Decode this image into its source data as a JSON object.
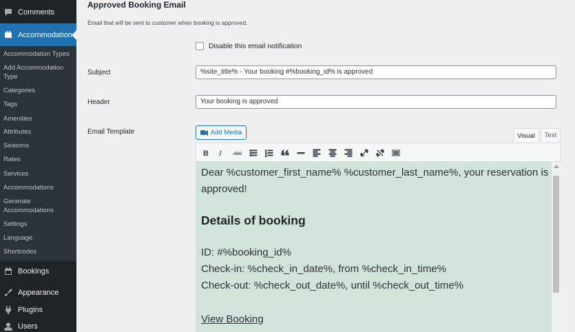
{
  "sidebar": {
    "comments_label": "Comments",
    "accommodation_label": "Accommodation",
    "submenu": [
      "Accommodation Types",
      "Add Accommodation Type",
      "Categories",
      "Tags",
      "Amenities",
      "Attributes",
      "Seasons",
      "Rates",
      "Services",
      "Accommodations",
      "Generate Accommodations",
      "Settings",
      "Language",
      "Shortcodes"
    ],
    "bookings_label": "Bookings",
    "appearance_label": "Appearance",
    "plugins_label": "Plugins",
    "users_label": "Users"
  },
  "section": {
    "title": "Approved Booking Email",
    "description": "Email that will be sent to customer when booking is approved."
  },
  "form": {
    "disable_label": "Disable this email notification",
    "subject_label": "Subject",
    "subject_value": "%site_title% - Your booking #%booking_id% is approved",
    "header_label": "Header",
    "header_value": "Your booking is approved",
    "template_label": "Email Template",
    "add_media_label": "Add Media",
    "tab_visual": "Visual",
    "tab_text": "Text"
  },
  "toolbar_icons": [
    "bold-icon",
    "italic-icon",
    "strikethrough-icon",
    "bullet-list-icon",
    "numbered-list-icon",
    "blockquote-icon",
    "horizontal-line-icon",
    "align-left-icon",
    "align-center-icon",
    "align-right-icon",
    "insert-link-icon",
    "remove-link-icon",
    "toolbar-toggle-icon"
  ],
  "editor": {
    "line1": "Dear %customer_first_name% %customer_last_name%, your reservation is",
    "line2": "approved!",
    "heading": "Details of booking",
    "id_line": "ID: #%booking_id%",
    "checkin_line": "Check-in: %check_in_date%, from %check_in_time%",
    "checkout_line": "Check-out: %check_out_date%, until %check_out_time%",
    "view_link": "View Booking"
  },
  "colors": {
    "sidebar_bg": "#1d2327",
    "submenu_bg": "#2c3338",
    "accent": "#2271b1",
    "editor_bg": "#d2e3dc"
  }
}
